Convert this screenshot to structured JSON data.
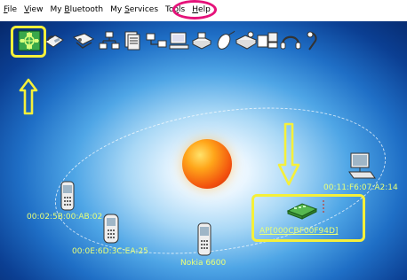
{
  "menu": {
    "file": {
      "underline": "F",
      "rest": "ile"
    },
    "view": {
      "underline": "V",
      "rest": "iew"
    },
    "my_bluetooth": {
      "prefix": "My ",
      "underline": "B",
      "rest": "luetooth"
    },
    "my_services": {
      "prefix": "My ",
      "underline": "S",
      "rest": "ervices"
    },
    "tools": {
      "prefix": "To",
      "underline": "o",
      "rest": "ls"
    },
    "help": {
      "underline": "H",
      "rest": "elp"
    }
  },
  "toolbar": {
    "icons": [
      "network-hub-icon",
      "fax-icon",
      "binoculars-icon",
      "network-icon",
      "document-icon",
      "network-connection-icon",
      "lan-access-icon",
      "printer-icon",
      "mouse-icon",
      "file-transfer-icon",
      "pim-sync-icon",
      "headset-icon",
      "audio-gateway-icon"
    ]
  },
  "devices": [
    {
      "label": "00:11:F6:07:A2:14",
      "icon": "computer-icon"
    },
    {
      "label": "00:02:5B:00:AB:02",
      "icon": "phone-icon"
    },
    {
      "label": "00:0E:6D:3C:EA:25",
      "icon": "phone-icon"
    },
    {
      "label": "Nokia 6600",
      "icon": "phone-icon"
    },
    {
      "label": "AP[000CBF00F94D]",
      "icon": "access-point-icon"
    }
  ],
  "colors": {
    "annotation": "#f5f03a",
    "help_highlight": "#e5137a",
    "background_center": "#ffffff",
    "background_edge": "#06286a",
    "label_text": "#e8ff7a"
  }
}
